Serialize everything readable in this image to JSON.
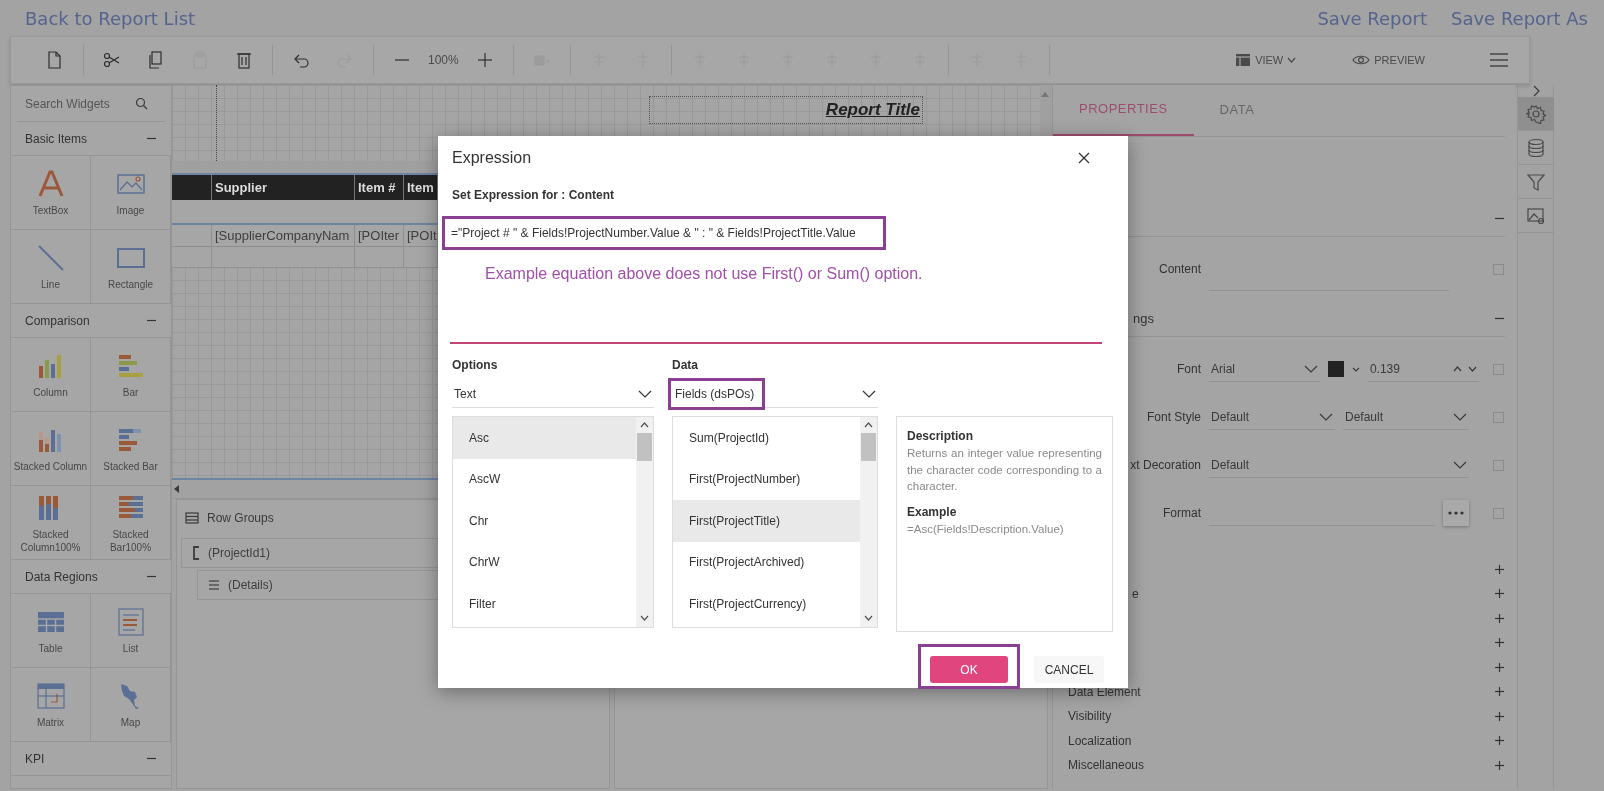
{
  "header": {
    "back_link": "Back to Report List",
    "actions": [
      "Save Report",
      "Save Report As"
    ]
  },
  "toolbar": {
    "groups": [
      [
        {
          "disabled": false
        }
      ],
      [
        {
          "disabled": false
        },
        {
          "disabled": false
        },
        {
          "disabled": true
        },
        {
          "disabled": false
        }
      ],
      [
        {
          "disabled": false
        },
        {
          "disabled": true
        }
      ],
      [
        {
          "disabled": false
        },
        {
          "disabled": false
        }
      ],
      [
        {
          "disabled": true
        }
      ],
      [
        {
          "disabled": true
        },
        {
          "disabled": true
        }
      ],
      [
        {
          "disabled": true
        },
        {
          "disabled": true
        },
        {
          "disabled": true
        },
        {
          "disabled": true
        },
        {
          "disabled": true
        },
        {
          "disabled": true
        }
      ],
      [
        {
          "disabled": true
        },
        {
          "disabled": true
        }
      ]
    ],
    "zoom": "100%",
    "view": "VIEW",
    "preview": "PREVIEW"
  },
  "widget_panel": {
    "search_placeholder": "Search Widgets",
    "sections": [
      {
        "title": "Basic Items",
        "expanded": true,
        "items": [
          "TextBox",
          "Image",
          "Line",
          "Rectangle"
        ]
      },
      {
        "title": "Comparison",
        "expanded": true,
        "items": [
          "Column",
          "Bar",
          "Stacked Column",
          "Stacked Bar",
          "Stacked Column100%",
          "Stacked Bar100%"
        ]
      },
      {
        "title": "Data Regions",
        "expanded": true,
        "items": [
          "Table",
          "List",
          "Matrix",
          "Map"
        ]
      },
      {
        "title": "KPI",
        "expanded": true
      }
    ]
  },
  "designer": {
    "report_title": "Report Title",
    "table": {
      "columns": [
        "Supplier",
        "Item #",
        "Item"
      ],
      "rows": [
        [
          "[SupplierCompanyNam",
          "[POIter",
          "[POIt"
        ]
      ]
    },
    "row_groups": {
      "title": "Row Groups",
      "groups": [
        {
          "label": "(ProjectId1)",
          "children": [
            {
              "label": "(Details)"
            }
          ]
        }
      ]
    }
  },
  "properties_panel": {
    "tabs": [
      {
        "label": "PROPERTIES",
        "selected": true
      },
      {
        "label": "DATA",
        "selected": false
      }
    ],
    "sections": [
      {
        "expanded": true,
        "rows": [
          {
            "kind": "text",
            "label": "Content",
            "checked": false
          }
        ]
      },
      {
        "title": "ngs",
        "expanded": true,
        "rows": [
          {
            "kind": "font",
            "label": "Font",
            "value": "Arial",
            "color": "#222222",
            "size": "0.139",
            "checked": false
          },
          {
            "kind": "pair",
            "label": "Font Style",
            "values": [
              "Default",
              "Default"
            ],
            "checked": false
          },
          {
            "kind": "select",
            "label": "xt Decoration",
            "value": "Default",
            "checked": false
          },
          {
            "kind": "format",
            "label": "Format",
            "checked": false
          }
        ]
      }
    ],
    "collapsed": [
      {
        "expanded": false
      },
      {
        "title": "e",
        "expanded": false
      },
      {
        "expanded": false
      },
      {
        "expanded": false
      },
      {
        "expanded": false
      },
      {
        "title": "Data Element",
        "expanded": false
      },
      {
        "title": "Visibility",
        "expanded": false
      },
      {
        "title": "Localization",
        "expanded": false
      },
      {
        "title": "Miscellaneous",
        "expanded": false
      }
    ]
  },
  "side_tools": [
    {
      "selected": true
    },
    {
      "selected": false
    },
    {
      "selected": false
    },
    {
      "selected": false
    }
  ],
  "dialog": {
    "title": "Expression",
    "subtitle": "Set Expression for : Content",
    "expression": {
      "value": "=\"Project # \" & Fields!ProjectNumber.Value & \" : \" & Fields!ProjectTitle.Value",
      "highlighted": true
    },
    "annotation": "Example equation above does not use First() or Sum() option.",
    "options": {
      "label": "Options",
      "value": "Text",
      "items": [
        {
          "label": "Asc",
          "selected": true
        },
        {
          "label": "AscW",
          "selected": false
        },
        {
          "label": "Chr",
          "selected": false
        },
        {
          "label": "ChrW",
          "selected": false
        },
        {
          "label": "Filter",
          "selected": false
        }
      ]
    },
    "data": {
      "label": "Data",
      "value": "Fields (dsPOs)",
      "highlighted": true,
      "items": [
        {
          "label": "Sum(ProjectId)",
          "selected": false
        },
        {
          "label": "First(ProjectNumber)",
          "selected": false
        },
        {
          "label": "First(ProjectTitle)",
          "selected": true
        },
        {
          "label": "First(ProjectArchived)",
          "selected": false
        },
        {
          "label": "First(ProjectCurrency)",
          "selected": false
        }
      ]
    },
    "description": {
      "title": "Description",
      "text": "Returns an integer value representing the character code corresponding to a character.",
      "example_title": "Example",
      "example": "=Asc(Fields!Description.Value)"
    },
    "buttons": [
      {
        "label": "OK",
        "primary": true,
        "highlighted": true
      },
      {
        "label": "CANCEL",
        "primary": false,
        "highlighted": false
      }
    ]
  }
}
